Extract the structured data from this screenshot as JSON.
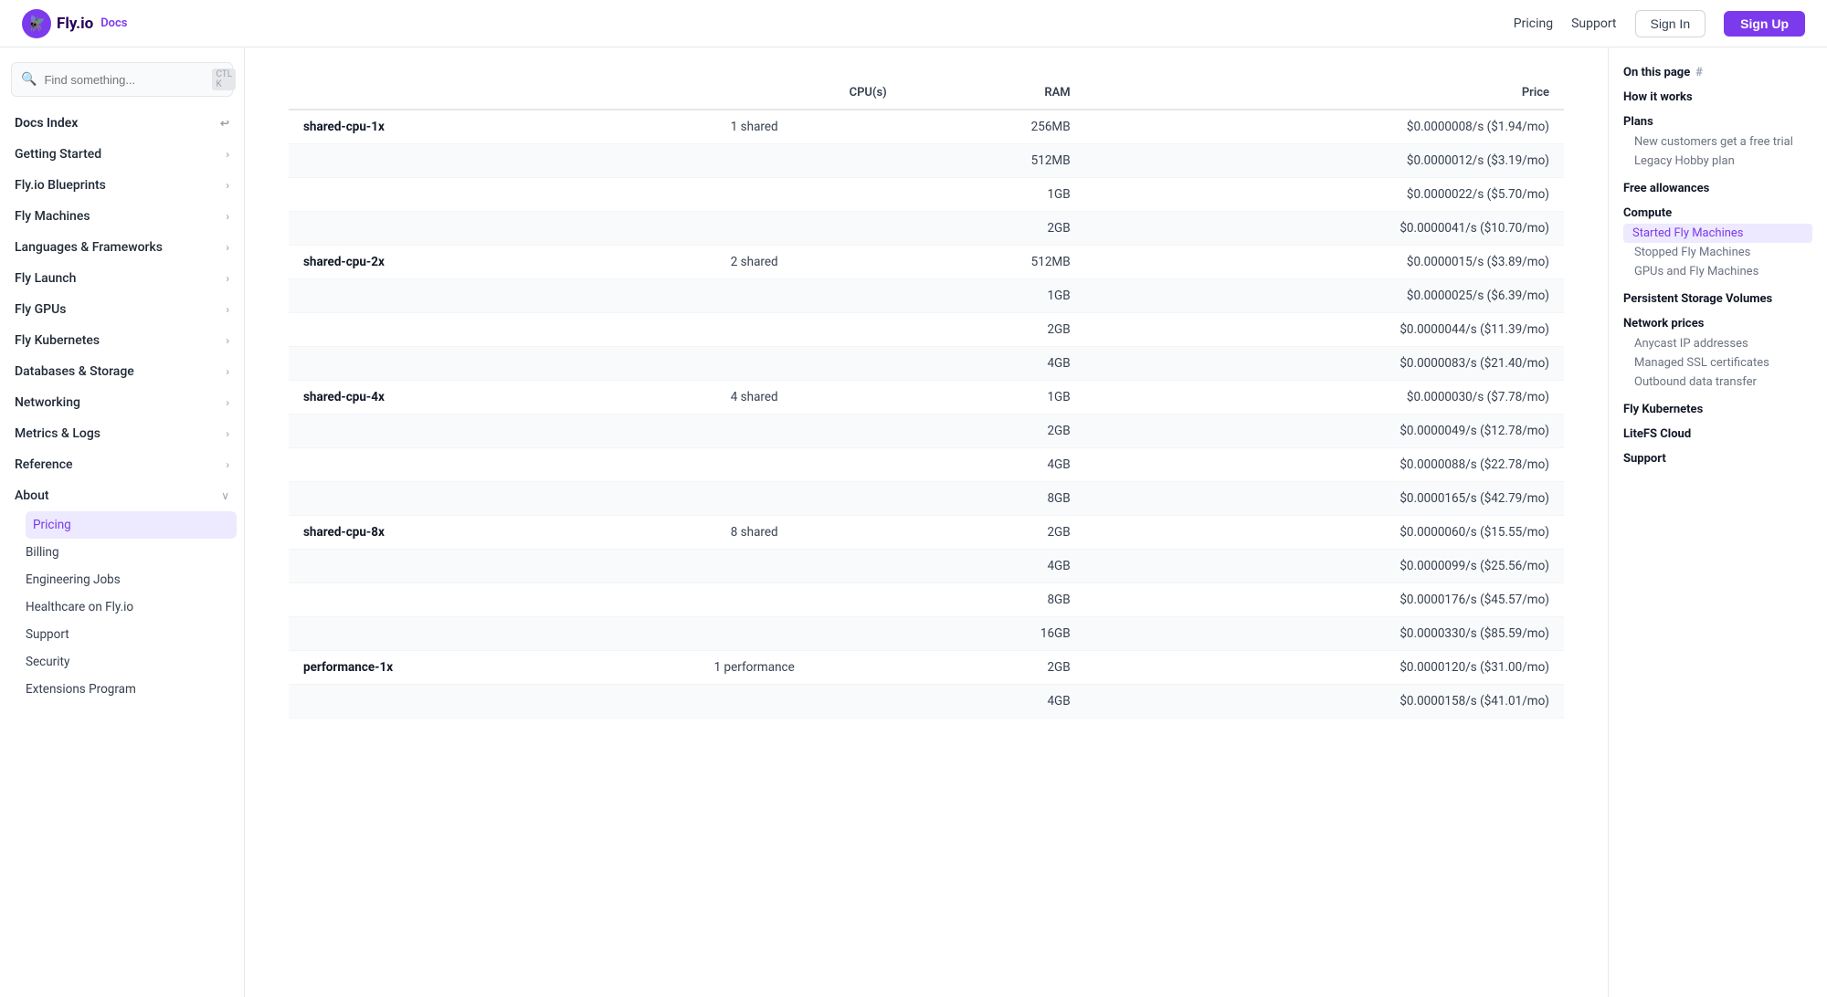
{
  "topnav": {
    "logo_text": "Fly.io",
    "logo_docs": "Docs",
    "links": [
      "Pricing",
      "Support"
    ],
    "signin_label": "Sign In",
    "signup_label": "Sign Up"
  },
  "search": {
    "placeholder": "Find something...",
    "shortcut": "CTL\nK"
  },
  "sidebar": {
    "docs_index": "Docs Index",
    "items": [
      {
        "label": "Getting Started",
        "expandable": true
      },
      {
        "label": "Fly.io Blueprints",
        "expandable": true
      },
      {
        "label": "Fly Machines",
        "expandable": true
      },
      {
        "label": "Languages & Frameworks",
        "expandable": true
      },
      {
        "label": "Fly Launch",
        "expandable": true
      },
      {
        "label": "Fly GPUs",
        "expandable": true
      },
      {
        "label": "Fly Kubernetes",
        "expandable": true
      },
      {
        "label": "Databases & Storage",
        "expandable": true
      },
      {
        "label": "Networking",
        "expandable": true
      },
      {
        "label": "Metrics & Logs",
        "expandable": true
      },
      {
        "label": "Reference",
        "expandable": true
      },
      {
        "label": "About",
        "expandable": true,
        "expanded": true
      }
    ],
    "about_sub": [
      {
        "label": "Pricing",
        "active": true
      },
      {
        "label": "Billing"
      },
      {
        "label": "Engineering Jobs"
      },
      {
        "label": "Healthcare on Fly.io"
      },
      {
        "label": "Support"
      },
      {
        "label": "Security"
      },
      {
        "label": "Extensions Program"
      }
    ]
  },
  "table": {
    "headers": [
      "",
      "CPU(s)",
      "RAM",
      "Price"
    ],
    "rows": [
      {
        "name": "shared-cpu-1x",
        "cpu": "1 shared",
        "ram": "256MB",
        "price": "$0.0000008/s ($1.94/mo)"
      },
      {
        "name": "",
        "cpu": "",
        "ram": "512MB",
        "price": "$0.0000012/s ($3.19/mo)"
      },
      {
        "name": "",
        "cpu": "",
        "ram": "1GB",
        "price": "$0.0000022/s ($5.70/mo)"
      },
      {
        "name": "",
        "cpu": "",
        "ram": "2GB",
        "price": "$0.0000041/s ($10.70/mo)"
      },
      {
        "name": "shared-cpu-2x",
        "cpu": "2 shared",
        "ram": "512MB",
        "price": "$0.0000015/s ($3.89/mo)"
      },
      {
        "name": "",
        "cpu": "",
        "ram": "1GB",
        "price": "$0.0000025/s ($6.39/mo)"
      },
      {
        "name": "",
        "cpu": "",
        "ram": "2GB",
        "price": "$0.0000044/s ($11.39/mo)"
      },
      {
        "name": "",
        "cpu": "",
        "ram": "4GB",
        "price": "$0.0000083/s ($21.40/mo)"
      },
      {
        "name": "shared-cpu-4x",
        "cpu": "4 shared",
        "ram": "1GB",
        "price": "$0.0000030/s ($7.78/mo)"
      },
      {
        "name": "",
        "cpu": "",
        "ram": "2GB",
        "price": "$0.0000049/s ($12.78/mo)"
      },
      {
        "name": "",
        "cpu": "",
        "ram": "4GB",
        "price": "$0.0000088/s ($22.78/mo)"
      },
      {
        "name": "",
        "cpu": "",
        "ram": "8GB",
        "price": "$0.0000165/s ($42.79/mo)"
      },
      {
        "name": "shared-cpu-8x",
        "cpu": "8 shared",
        "ram": "2GB",
        "price": "$0.0000060/s ($15.55/mo)"
      },
      {
        "name": "",
        "cpu": "",
        "ram": "4GB",
        "price": "$0.0000099/s ($25.56/mo)"
      },
      {
        "name": "",
        "cpu": "",
        "ram": "8GB",
        "price": "$0.0000176/s ($45.57/mo)"
      },
      {
        "name": "",
        "cpu": "",
        "ram": "16GB",
        "price": "$0.0000330/s ($85.59/mo)"
      },
      {
        "name": "performance-1x",
        "cpu": "1 performance",
        "ram": "2GB",
        "price": "$0.0000120/s ($31.00/mo)"
      },
      {
        "name": "",
        "cpu": "",
        "ram": "4GB",
        "price": "$0.0000158/s ($41.01/mo)"
      }
    ]
  },
  "toc": {
    "title": "On this page",
    "sections": [
      {
        "label": "How it works",
        "type": "section"
      },
      {
        "label": "Plans",
        "type": "section"
      },
      {
        "label": "New customers get a free trial",
        "type": "link"
      },
      {
        "label": "Legacy Hobby plan",
        "type": "link"
      },
      {
        "label": "Free allowances",
        "type": "section"
      },
      {
        "label": "Compute",
        "type": "section"
      },
      {
        "label": "Started Fly Machines",
        "type": "link",
        "active": true
      },
      {
        "label": "Stopped Fly Machines",
        "type": "link"
      },
      {
        "label": "GPUs and Fly Machines",
        "type": "link"
      },
      {
        "label": "Persistent Storage Volumes",
        "type": "section"
      },
      {
        "label": "Network prices",
        "type": "section"
      },
      {
        "label": "Anycast IP addresses",
        "type": "link"
      },
      {
        "label": "Managed SSL certificates",
        "type": "link"
      },
      {
        "label": "Outbound data transfer",
        "type": "link"
      },
      {
        "label": "Fly Kubernetes",
        "type": "section"
      },
      {
        "label": "LiteFS Cloud",
        "type": "section"
      },
      {
        "label": "Support",
        "type": "section"
      }
    ]
  }
}
